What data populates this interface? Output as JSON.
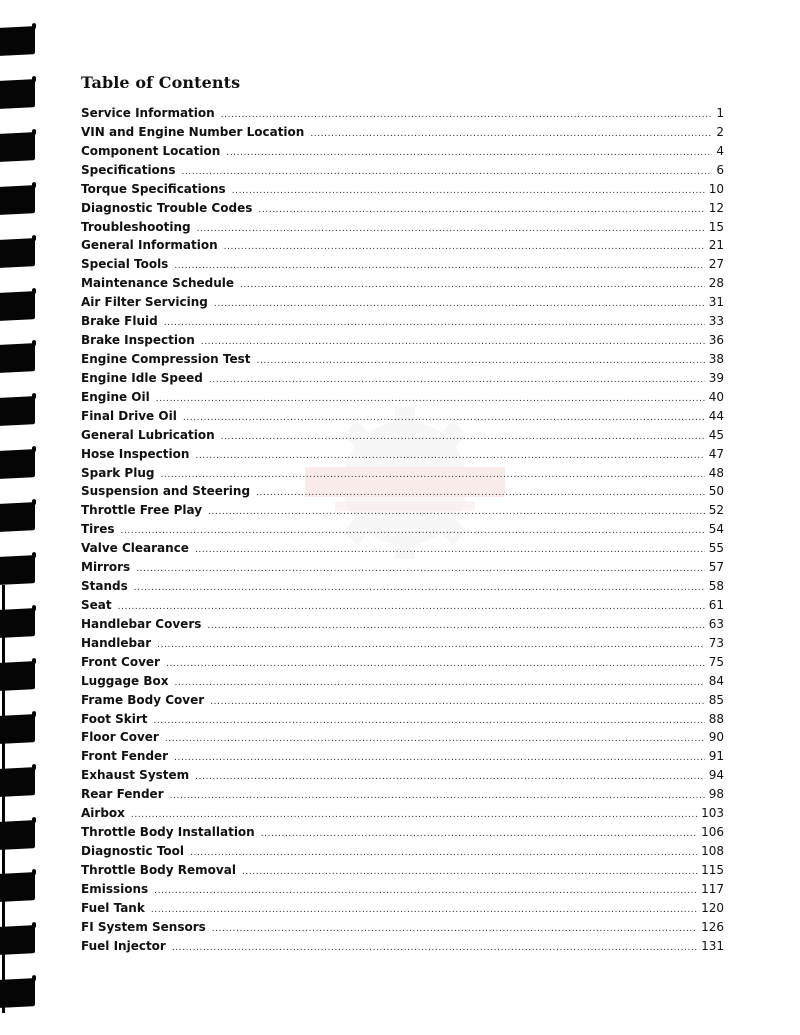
{
  "document": {
    "title": "Table of Contents",
    "entries": [
      {
        "label": "Service Information",
        "page": "1"
      },
      {
        "label": "VIN and Engine Number Location",
        "page": "2"
      },
      {
        "label": "Component Location",
        "page": "4"
      },
      {
        "label": "Specifications",
        "page": "6"
      },
      {
        "label": "Torque Specifications",
        "page": "10"
      },
      {
        "label": "Diagnostic Trouble Codes",
        "page": "12"
      },
      {
        "label": "Troubleshooting",
        "page": "15"
      },
      {
        "label": "General Information",
        "page": "21"
      },
      {
        "label": "Special Tools",
        "page": "27"
      },
      {
        "label": "Maintenance Schedule",
        "page": "28"
      },
      {
        "label": "Air Filter Servicing",
        "page": "31"
      },
      {
        "label": "Brake Fluid",
        "page": "33"
      },
      {
        "label": "Brake Inspection",
        "page": "36"
      },
      {
        "label": "Engine Compression Test",
        "page": "38"
      },
      {
        "label": "Engine Idle Speed",
        "page": "39"
      },
      {
        "label": "Engine Oil",
        "page": "40"
      },
      {
        "label": "Final Drive Oil",
        "page": "44"
      },
      {
        "label": "General Lubrication",
        "page": "45"
      },
      {
        "label": "Hose Inspection",
        "page": "47"
      },
      {
        "label": "Spark Plug",
        "page": "48"
      },
      {
        "label": "Suspension and Steering",
        "page": "50"
      },
      {
        "label": "Throttle Free Play",
        "page": "52"
      },
      {
        "label": "Tires",
        "page": "54"
      },
      {
        "label": "Valve Clearance",
        "page": "55"
      },
      {
        "label": "Mirrors",
        "page": "57"
      },
      {
        "label": "Stands",
        "page": "58"
      },
      {
        "label": "Seat",
        "page": "61"
      },
      {
        "label": "Handlebar Covers",
        "page": "63"
      },
      {
        "label": "Handlebar",
        "page": "73"
      },
      {
        "label": "Front Cover",
        "page": "75"
      },
      {
        "label": "Luggage Box",
        "page": "84"
      },
      {
        "label": "Frame Body Cover",
        "page": "85"
      },
      {
        "label": "Foot Skirt",
        "page": "88"
      },
      {
        "label": "Floor Cover",
        "page": "90"
      },
      {
        "label": "Front Fender",
        "page": "91"
      },
      {
        "label": "Exhaust System",
        "page": "94"
      },
      {
        "label": "Rear Fender",
        "page": "98"
      },
      {
        "label": "Airbox",
        "page": "103"
      },
      {
        "label": "Throttle Body Installation",
        "page": "106"
      },
      {
        "label": "Diagnostic Tool",
        "page": "108"
      },
      {
        "label": "Throttle Body Removal",
        "page": "115"
      },
      {
        "label": "Emissions",
        "page": "117"
      },
      {
        "label": "Fuel Tank",
        "page": "120"
      },
      {
        "label": "FI System Sensors",
        "page": "126"
      },
      {
        "label": "Fuel Injector",
        "page": "131"
      }
    ]
  },
  "decorations": {
    "binding_icon": "spiral-binding-comb",
    "watermark_icon": "gear-logo-watermark",
    "watermark_color": "#d32f2f",
    "ink_color": "#111111"
  }
}
